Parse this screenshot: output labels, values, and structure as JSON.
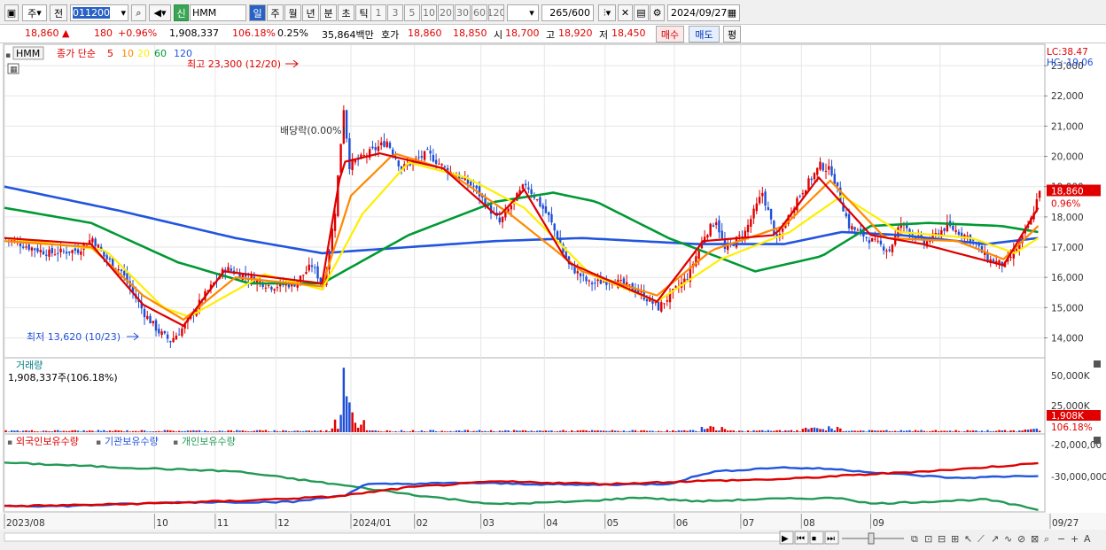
{
  "toolbar": {
    "market_label": "주",
    "prev_label": "전",
    "code": "011200",
    "stock_name": "HMM",
    "credit_badge": "신",
    "periods": [
      "일",
      "주",
      "월",
      "년",
      "분",
      "초",
      "틱"
    ],
    "active_period": "일",
    "intervals": [
      "1",
      "3",
      "5",
      "10",
      "20",
      "30",
      "60",
      "120"
    ],
    "count": "265",
    "count_total": "/600",
    "date": "2024/09/27"
  },
  "quote": {
    "price": "18,860",
    "arrow": "▲",
    "change": "180",
    "change_pct": "+0.96%",
    "volume": "1,908,337",
    "volume_ratio": "106.18%",
    "turnover": "0.25%",
    "amount": "35,864백만",
    "bid_label": "호가",
    "bid1": "18,860",
    "bid2": "18,850",
    "open_label": "시",
    "open": "18,700",
    "high_label": "고",
    "high": "18,920",
    "low_label": "저",
    "low": "18,450",
    "buy_label": "매수",
    "sell_label": "매도",
    "avg_label": "평"
  },
  "price_panel": {
    "ticker": "HMM",
    "legend_prefix": "종가 단순",
    "ma_periods": [
      "5",
      "10",
      "20",
      "60",
      "120"
    ],
    "ma_colors": [
      "#dd0000",
      "#ff8800",
      "#ffee00",
      "#009933",
      "#2255dd"
    ],
    "lc": "LC:38.47",
    "hc": "HC:-19.06",
    "y_ticks": [
      "23,000",
      "22,000",
      "21,000",
      "20,000",
      "19,000",
      "18,000",
      "17,000",
      "16,000",
      "15,000",
      "14,000"
    ],
    "y_tick_values": [
      23000,
      22000,
      21000,
      20000,
      19000,
      18000,
      17000,
      16000,
      15000,
      14000
    ],
    "high_note": "최고 23,300 (12/20)",
    "low_note": "최저 13,620 (10/23)",
    "dividend_note": "배당락(0.00%)",
    "last_price_label": "18,860",
    "last_pct_label": "0.96%"
  },
  "volume_panel": {
    "title": "거래량",
    "subtitle": "1,908,337주(106.18%)",
    "y_ticks": [
      "50,000K",
      "25,000K"
    ],
    "last_label": "1,908K",
    "last_pct": "106.18%"
  },
  "holdings_panel": {
    "legend": [
      "외국인보유수량",
      "기관보유수량",
      "개인보유수량"
    ],
    "legend_colors": [
      "#dd0000",
      "#2255dd",
      "#229955"
    ],
    "y_ticks": [
      "-20,000,00",
      "-30,000,000"
    ]
  },
  "x_axis": {
    "labels": [
      "2023/08",
      "10",
      "11",
      "12",
      "2024/01",
      "02",
      "03",
      "04",
      "05",
      "06",
      "07",
      "08",
      "09",
      "09/27"
    ]
  },
  "chart_data": {
    "type": "candlestick",
    "start": "2023/08",
    "end": "2024/09/27",
    "ylim": [
      13400,
      23500
    ],
    "close_path": [
      [
        0,
        17300
      ],
      [
        8,
        17000
      ],
      [
        15,
        16800
      ],
      [
        25,
        16900
      ],
      [
        30,
        17300
      ],
      [
        34,
        16700
      ],
      [
        40,
        16200
      ],
      [
        48,
        14800
      ],
      [
        53,
        14200
      ],
      [
        57,
        13900
      ],
      [
        62,
        14400
      ],
      [
        68,
        15300
      ],
      [
        76,
        16300
      ],
      [
        84,
        16000
      ],
      [
        92,
        15700
      ],
      [
        100,
        15800
      ],
      [
        106,
        16400
      ],
      [
        110,
        15700
      ],
      [
        114,
        18200
      ],
      [
        117,
        21600
      ],
      [
        119,
        19700
      ],
      [
        124,
        20000
      ],
      [
        132,
        20500
      ],
      [
        137,
        19600
      ],
      [
        146,
        20100
      ],
      [
        152,
        19600
      ],
      [
        162,
        19000
      ],
      [
        171,
        17800
      ],
      [
        180,
        19100
      ],
      [
        188,
        18000
      ],
      [
        195,
        16400
      ],
      [
        202,
        15800
      ],
      [
        210,
        15900
      ],
      [
        218,
        15600
      ],
      [
        226,
        15000
      ],
      [
        230,
        15400
      ],
      [
        236,
        16000
      ],
      [
        242,
        17400
      ],
      [
        246,
        17900
      ],
      [
        249,
        16900
      ],
      [
        256,
        17500
      ],
      [
        262,
        18800
      ],
      [
        267,
        17200
      ],
      [
        274,
        18600
      ],
      [
        282,
        19700
      ],
      [
        286,
        19500
      ],
      [
        292,
        17700
      ],
      [
        300,
        17200
      ],
      [
        306,
        16900
      ],
      [
        310,
        17800
      ],
      [
        318,
        17100
      ],
      [
        326,
        17700
      ],
      [
        334,
        17300
      ],
      [
        340,
        16600
      ],
      [
        346,
        16400
      ],
      [
        351,
        17100
      ],
      [
        355,
        17900
      ],
      [
        358,
        18860
      ]
    ],
    "ma5": [
      [
        0,
        17300
      ],
      [
        30,
        17100
      ],
      [
        48,
        15100
      ],
      [
        62,
        14400
      ],
      [
        76,
        16200
      ],
      [
        110,
        15800
      ],
      [
        117,
        19800
      ],
      [
        130,
        20100
      ],
      [
        152,
        19600
      ],
      [
        171,
        18000
      ],
      [
        180,
        18900
      ],
      [
        195,
        16500
      ],
      [
        226,
        15200
      ],
      [
        242,
        17200
      ],
      [
        267,
        17400
      ],
      [
        282,
        19300
      ],
      [
        300,
        17400
      ],
      [
        318,
        17100
      ],
      [
        346,
        16400
      ],
      [
        358,
        18300
      ]
    ],
    "ma10": [
      [
        0,
        17200
      ],
      [
        30,
        17000
      ],
      [
        48,
        15400
      ],
      [
        62,
        14600
      ],
      [
        80,
        16000
      ],
      [
        110,
        15700
      ],
      [
        120,
        18700
      ],
      [
        135,
        20100
      ],
      [
        152,
        19600
      ],
      [
        175,
        18100
      ],
      [
        200,
        16200
      ],
      [
        226,
        15400
      ],
      [
        245,
        16900
      ],
      [
        270,
        17700
      ],
      [
        286,
        19200
      ],
      [
        305,
        17300
      ],
      [
        330,
        17200
      ],
      [
        346,
        16600
      ],
      [
        358,
        17700
      ]
    ],
    "ma20": [
      [
        0,
        17300
      ],
      [
        35,
        16900
      ],
      [
        55,
        15000
      ],
      [
        64,
        14700
      ],
      [
        90,
        16100
      ],
      [
        110,
        15600
      ],
      [
        124,
        18100
      ],
      [
        140,
        19800
      ],
      [
        160,
        19300
      ],
      [
        180,
        18300
      ],
      [
        203,
        16100
      ],
      [
        226,
        15200
      ],
      [
        248,
        16600
      ],
      [
        272,
        17500
      ],
      [
        290,
        18700
      ],
      [
        310,
        17500
      ],
      [
        335,
        17300
      ],
      [
        350,
        16800
      ],
      [
        358,
        17300
      ]
    ],
    "ma60": [
      [
        0,
        18300
      ],
      [
        30,
        17800
      ],
      [
        60,
        16500
      ],
      [
        85,
        15800
      ],
      [
        110,
        15800
      ],
      [
        140,
        17400
      ],
      [
        170,
        18500
      ],
      [
        190,
        18800
      ],
      [
        205,
        18500
      ],
      [
        230,
        17300
      ],
      [
        260,
        16200
      ],
      [
        283,
        16700
      ],
      [
        300,
        17700
      ],
      [
        320,
        17800
      ],
      [
        345,
        17700
      ],
      [
        358,
        17500
      ]
    ],
    "ma120": [
      [
        0,
        19000
      ],
      [
        40,
        18200
      ],
      [
        80,
        17300
      ],
      [
        110,
        16800
      ],
      [
        140,
        17000
      ],
      [
        170,
        17200
      ],
      [
        200,
        17300
      ],
      [
        240,
        17100
      ],
      [
        270,
        17100
      ],
      [
        290,
        17500
      ],
      [
        310,
        17400
      ],
      [
        340,
        17100
      ],
      [
        358,
        17300
      ]
    ],
    "volume_max": 55000,
    "foreign_holdings": [
      [
        0,
        -33500
      ],
      [
        40,
        -33100
      ],
      [
        80,
        -32400
      ],
      [
        115,
        -31500
      ],
      [
        140,
        -29600
      ],
      [
        170,
        -28400
      ],
      [
        210,
        -28900
      ],
      [
        240,
        -28300
      ],
      [
        270,
        -27900
      ],
      [
        300,
        -26900
      ],
      [
        330,
        -25900
      ],
      [
        352,
        -24900
      ],
      [
        358,
        -24700
      ]
    ],
    "institution_holdings": [
      [
        0,
        -33400
      ],
      [
        20,
        -33500
      ],
      [
        60,
        -32700
      ],
      [
        100,
        -32600
      ],
      [
        118,
        -31200
      ],
      [
        125,
        -29000
      ],
      [
        160,
        -28700
      ],
      [
        200,
        -29100
      ],
      [
        230,
        -28900
      ],
      [
        245,
        -26400
      ],
      [
        268,
        -25500
      ],
      [
        286,
        -25800
      ],
      [
        310,
        -26900
      ],
      [
        330,
        -27700
      ],
      [
        350,
        -27300
      ],
      [
        358,
        -27200
      ]
    ],
    "individual_holdings": [
      [
        0,
        -24500
      ],
      [
        40,
        -25500
      ],
      [
        80,
        -26300
      ],
      [
        115,
        -29000
      ],
      [
        145,
        -31400
      ],
      [
        170,
        -33100
      ],
      [
        200,
        -32500
      ],
      [
        220,
        -31700
      ],
      [
        240,
        -32500
      ],
      [
        265,
        -32000
      ],
      [
        290,
        -31800
      ],
      [
        300,
        -33000
      ],
      [
        340,
        -32100
      ],
      [
        358,
        -34200
      ]
    ]
  }
}
